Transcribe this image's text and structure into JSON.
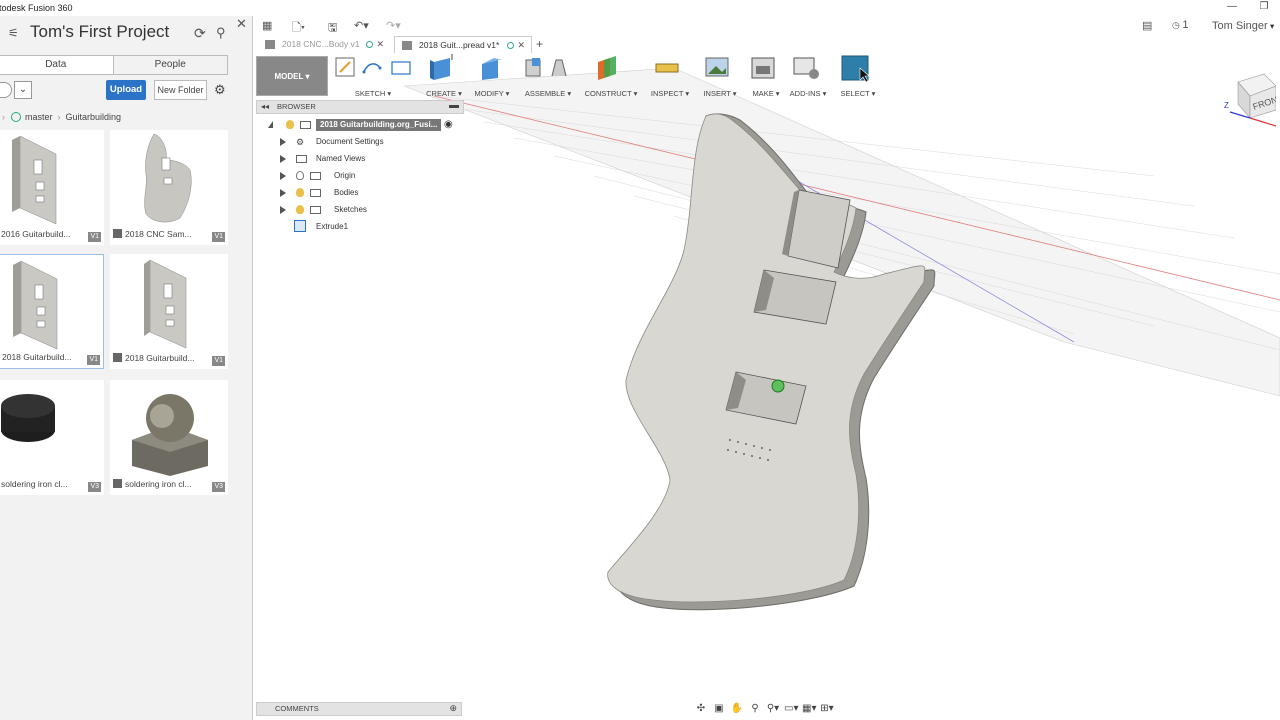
{
  "window": {
    "title": "utodesk Fusion 360",
    "minimize": "—",
    "restore": "❐"
  },
  "data_panel": {
    "project_title": "Tom's First Project",
    "tabs": [
      {
        "label": "Data",
        "active": true
      },
      {
        "label": "People",
        "active": false
      }
    ],
    "upload_label": "Upload",
    "new_folder_label": "New Folder",
    "breadcrumb": [
      "master",
      "Guitarbuilding"
    ],
    "items": [
      {
        "caption": "2016 Guitarbuild...",
        "version": "V1"
      },
      {
        "caption": "2018 CNC Sam...",
        "version": "V1"
      },
      {
        "caption": "2018 Guitarbuild...",
        "version": "V1",
        "selected": true
      },
      {
        "caption": "2018 Guitarbuild...",
        "version": "V1"
      },
      {
        "caption": "soldering iron cl...",
        "version": "V3"
      },
      {
        "caption": "soldering iron cl...",
        "version": "V3"
      }
    ]
  },
  "toolbar": {
    "user_name": "Tom Singer",
    "job_count": "1"
  },
  "doc_tabs": [
    {
      "label": "2018 CNC...Body v1",
      "active": false
    },
    {
      "label": "2018 Guit...pread v1*",
      "active": true
    }
  ],
  "ribbon": {
    "workspace": "MODEL ▾",
    "groups": [
      {
        "label": "SKETCH ▾"
      },
      {
        "label": "CREATE ▾"
      },
      {
        "label": "MODIFY ▾"
      },
      {
        "label": "ASSEMBLE ▾"
      },
      {
        "label": "CONSTRUCT ▾"
      },
      {
        "label": "INSPECT ▾"
      },
      {
        "label": "INSERT ▾"
      },
      {
        "label": "MAKE ▾"
      },
      {
        "label": "ADD-INS ▾"
      },
      {
        "label": "SELECT ▾"
      }
    ]
  },
  "browser": {
    "title": "BROWSER",
    "root": "2018 Guitarbuilding.org_Fusi...",
    "nodes": [
      {
        "label": "Document Settings"
      },
      {
        "label": "Named Views"
      },
      {
        "label": "Origin"
      },
      {
        "label": "Bodies"
      },
      {
        "label": "Sketches"
      },
      {
        "label": "Extrude1"
      }
    ]
  },
  "comments_label": "COMMENTS",
  "viewcube": {
    "face": "FRONT",
    "axis_z": "Z"
  },
  "colors": {
    "accent": "#2b73c6",
    "ribbon_active": "#2d7ea8",
    "body": "#d8d7d2",
    "body_edge": "#8a8882"
  }
}
